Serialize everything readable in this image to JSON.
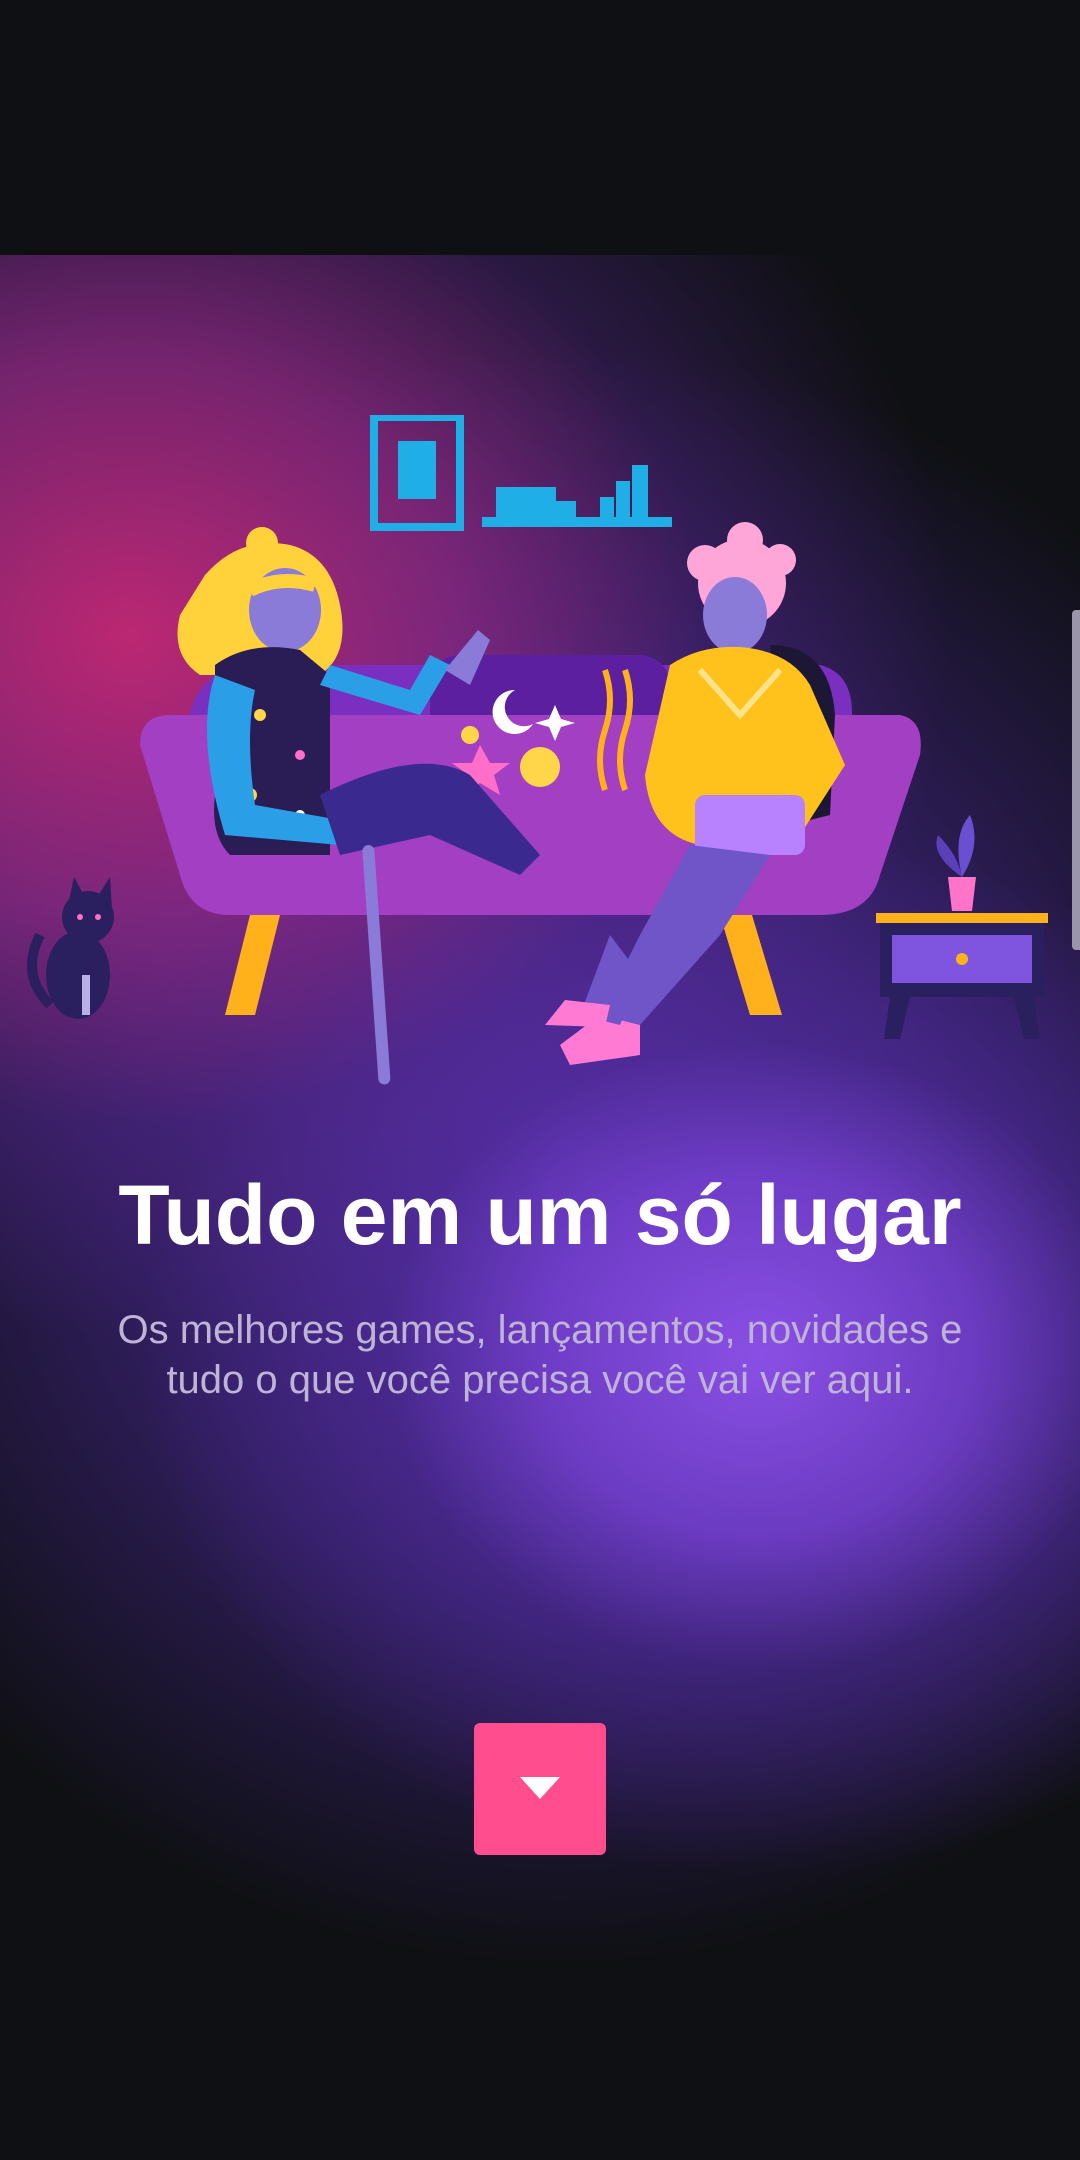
{
  "onboarding": {
    "title": "Tudo em um só lugar",
    "subtitle": "Os melhores games, lançamentos, novidades e tudo o que você precisa você vai ver aqui.",
    "next_button_icon": "caret-down-icon"
  },
  "colors": {
    "background": "#0f1014",
    "accent": "#ff4d8d",
    "title": "#ffffff",
    "subtitle": "#bfb3d6"
  }
}
